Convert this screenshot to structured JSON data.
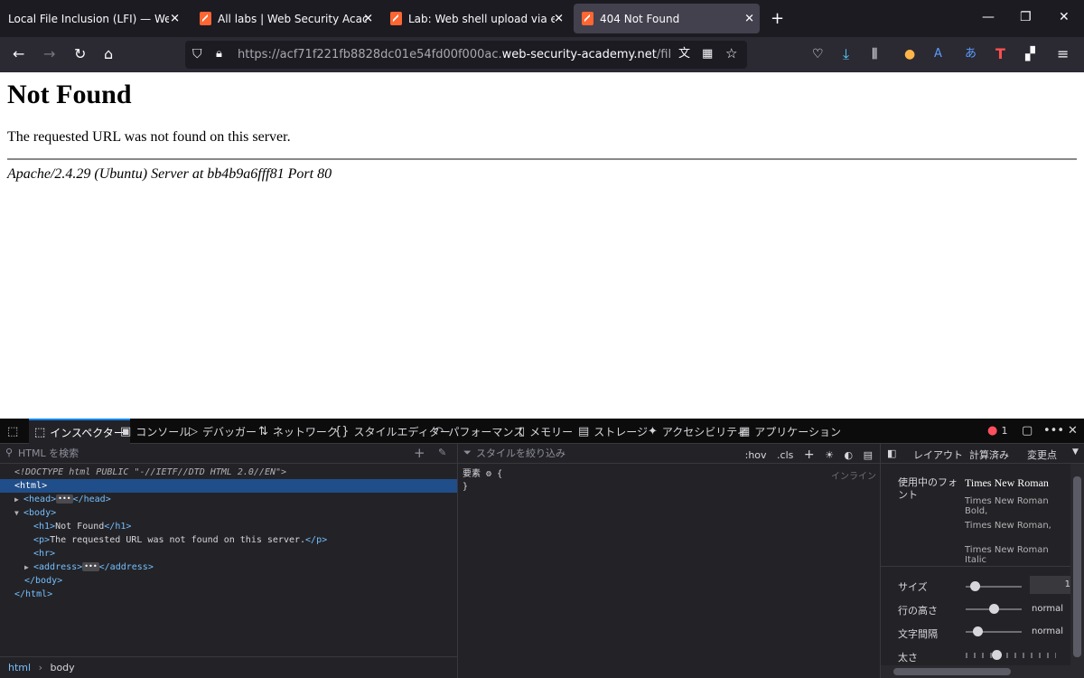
{
  "tabs": [
    {
      "title": "Local File Inclusion (LFI) — Web App",
      "active": false
    },
    {
      "title": "All labs | Web Security Academy",
      "active": false
    },
    {
      "title": "Lab: Web shell upload via exten",
      "active": false
    },
    {
      "title": "404 Not Found",
      "active": true
    }
  ],
  "url": {
    "prefix": "https://acf71f221fb8828dc01e54fd00f000ac.",
    "domain": "web-security-academy.net",
    "path": "/files/avatars/"
  },
  "page": {
    "heading": "Not Found",
    "message": "The requested URL was not found on this server.",
    "address": "Apache/2.4.29 (Ubuntu) Server at bb4b9a6fff81 Port 80"
  },
  "devtools": {
    "tabs": [
      "インスペクター",
      "コンソール",
      "デバッガー",
      "ネットワーク",
      "スタイルエディター",
      "パフォーマンス",
      "メモリー",
      "ストレージ",
      "アクセシビリティ",
      "アプリケーション"
    ],
    "error_count": "1",
    "html_search_placeholder": "HTML を検索",
    "style_filter_placeholder": "スタイルを絞り込み",
    "hov": ":hov",
    "cls": ".cls",
    "dom": {
      "doctype": "<!DOCTYPE html PUBLIC \"-//IETF//DTD HTML 2.0//EN\">",
      "h1_text": "Not Found",
      "p_text": "The requested URL was not found on this server."
    },
    "breadcrumb": [
      "html",
      "body"
    ],
    "rule_selector": "要素",
    "rule_inline": "インライン",
    "side_tabs": [
      "レイアウト",
      "計算済み",
      "変更点"
    ],
    "fonts": {
      "label": "使用中のフォント",
      "main": "Times New Roman",
      "variants": [
        "Times New Roman Bold,",
        "Times New Roman,",
        "Times New Roman Italic"
      ]
    },
    "props": [
      {
        "label": "サイズ",
        "value": "1"
      },
      {
        "label": "行の高さ",
        "value": "normal"
      },
      {
        "label": "文字間隔",
        "value": "normal"
      },
      {
        "label": "太さ",
        "value": ""
      }
    ]
  }
}
